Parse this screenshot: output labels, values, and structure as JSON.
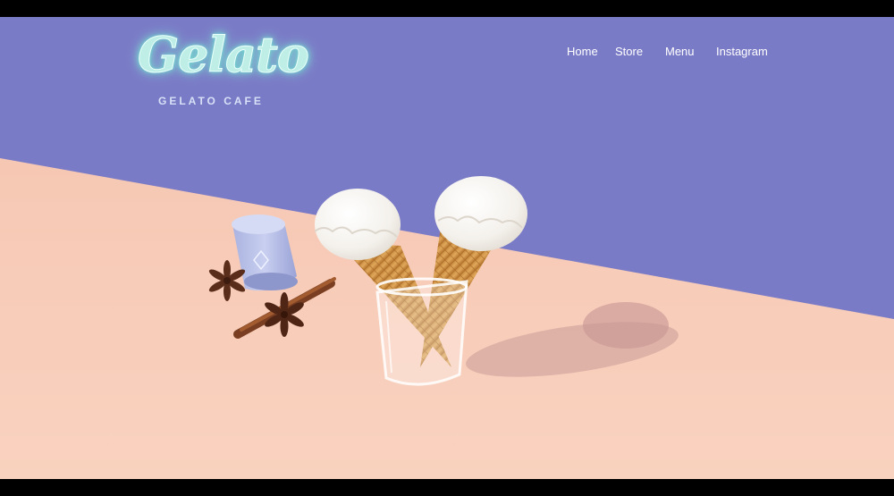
{
  "site": {
    "logo_script": "Gelato",
    "logo_subtitle": "GELATO CAFE"
  },
  "nav": {
    "items": [
      {
        "label": "Home"
      },
      {
        "label": "Store"
      },
      {
        "label": "Menu"
      },
      {
        "label": "Instagram"
      }
    ]
  },
  "colors": {
    "sky": "#7a7bc6",
    "table": "#f7cdb8",
    "frame": "#000000",
    "nav_text": "#ffffff",
    "logo_glow": "#bfeee6"
  }
}
